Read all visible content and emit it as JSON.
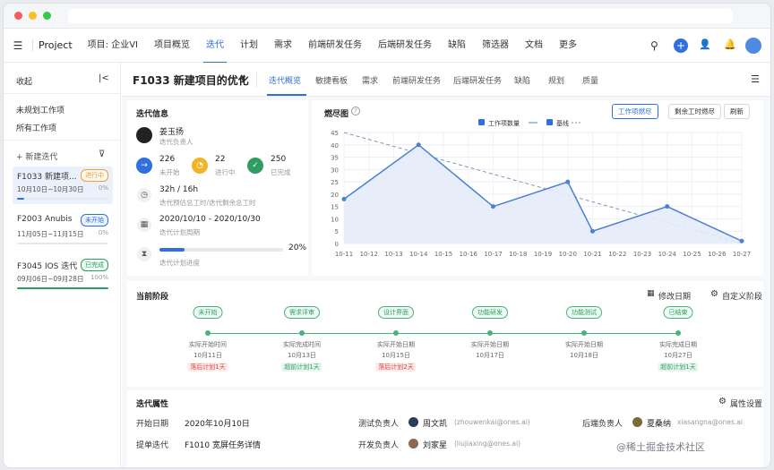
{
  "colors": {
    "accent": "#2f6fe0",
    "green": "#2f9c62",
    "orange": "#e8a23a",
    "red": "#d9453c"
  },
  "nav": {
    "project_label": "Project",
    "project_scope": "项目: 企业VI",
    "items": [
      "项目概览",
      "迭代",
      "计划",
      "需求",
      "前端研发任务",
      "后端研发任务",
      "缺陷",
      "筛选器",
      "文档",
      "更多"
    ]
  },
  "sidebar": {
    "collapse": "收起",
    "unplanned": "未规划工作项",
    "all": "所有工作项",
    "new_iteration": "+ 新建迭代",
    "iterations": [
      {
        "name": "F1033 新建项...",
        "status": "进行中",
        "dates": "10月10日~10月30日",
        "progress": "0%"
      },
      {
        "name": "F2003 Anubis",
        "status": "未开始",
        "dates": "11月05日~11月15日",
        "progress": "0%"
      },
      {
        "name": "F3045 IOS 迭代",
        "status": "已完成",
        "dates": "09月06日~09月28日",
        "progress": "100%"
      }
    ]
  },
  "header": {
    "title": "F1033 新建项目的优化",
    "tabs": [
      "迭代概览",
      "敏捷看板",
      "需求",
      "前端研发任务",
      "后端研发任务",
      "缺陷",
      "规划",
      "质量"
    ]
  },
  "info": {
    "title": "迭代信息",
    "owner_name": "姜玉扬",
    "owner_role": "迭代负责人",
    "stat1_value": "226",
    "stat1_label": "未开始",
    "stat2_value": "22",
    "stat2_label": "进行中",
    "stat3_value": "250",
    "stat3_label": "已完成",
    "hours_value": "32h / 16h",
    "hours_label": "迭代预估总工时/迭代剩余总工时",
    "cycle_value": "2020/10/10 - 2020/10/30",
    "cycle_label": "迭代计划周期",
    "progress_label": "迭代计划进度",
    "progress_value": "20%",
    "progress": 0.2
  },
  "burndown": {
    "title": "燃尽图",
    "btn_items": "工作项燃尽",
    "btn_hours": "剩余工时燃尽",
    "btn_refresh": "刷新",
    "legend_count": "工作项数量",
    "legend_baseline": "基线"
  },
  "chart_data": {
    "type": "line",
    "ylim": [
      0,
      45
    ],
    "yticks": [
      0,
      5,
      10,
      15,
      20,
      25,
      30,
      35,
      40,
      45
    ],
    "categories": [
      "10-11",
      "10-12",
      "10-13",
      "10-14",
      "10-15",
      "10-16",
      "10-17",
      "10-18",
      "10-19",
      "10-20",
      "10-21",
      "10-22",
      "10-23",
      "10-24",
      "10-25",
      "10-26",
      "10-27"
    ],
    "series": [
      {
        "name": "工作项数量",
        "values": [
          18,
          null,
          null,
          40,
          null,
          null,
          15,
          null,
          null,
          25,
          5,
          null,
          null,
          15,
          null,
          null,
          1
        ]
      },
      {
        "name": "基线",
        "values": [
          45,
          null,
          null,
          null,
          null,
          null,
          null,
          null,
          null,
          null,
          null,
          null,
          null,
          null,
          null,
          null,
          0
        ]
      }
    ]
  },
  "stages": {
    "title": "当前阶段",
    "modify_date": "修改日期",
    "custom": "自定义阶段",
    "items": [
      {
        "tag": "未开始",
        "l1": "实际开始时间",
        "l2": "10月11日",
        "badge": "落后计划1天",
        "ok": false
      },
      {
        "tag": "需求评审",
        "l1": "实际完成时间",
        "l2": "10月13日",
        "badge": "超前计划1天",
        "ok": true
      },
      {
        "tag": "设计界面",
        "l1": "实际开始日期",
        "l2": "10月15日",
        "badge": "落后计划2天",
        "ok": false
      },
      {
        "tag": "功能研发",
        "l1": "实际开始日期",
        "l2": "10月17日",
        "badge": "",
        "ok": true
      },
      {
        "tag": "功能测试",
        "l1": "实际开始日期",
        "l2": "10月18日",
        "badge": "",
        "ok": true
      },
      {
        "tag": "已结束",
        "l1": "实际完成日期",
        "l2": "10月27日",
        "badge": "超前计划1天",
        "ok": true
      }
    ]
  },
  "props": {
    "title": "迭代属性",
    "settings": "属性设置",
    "start_label": "开始日期",
    "start_value": "2020年10月10日",
    "prev_label": "提单迭代",
    "prev_value": "F1010 宽屏任务详情",
    "test_label": "测试负责人",
    "test_name": "周文凯",
    "test_email": "(zhouwenkai@ones.ai)",
    "dev_label": "开发负责人",
    "dev_name": "刘家星",
    "dev_email": "(liujiaxing@ones.ai)",
    "back_label": "后端负责人",
    "back_name": "夏桑纳",
    "back_email": "xiasangna@ones.ai"
  },
  "watermark": "@稀土掘金技术社区"
}
